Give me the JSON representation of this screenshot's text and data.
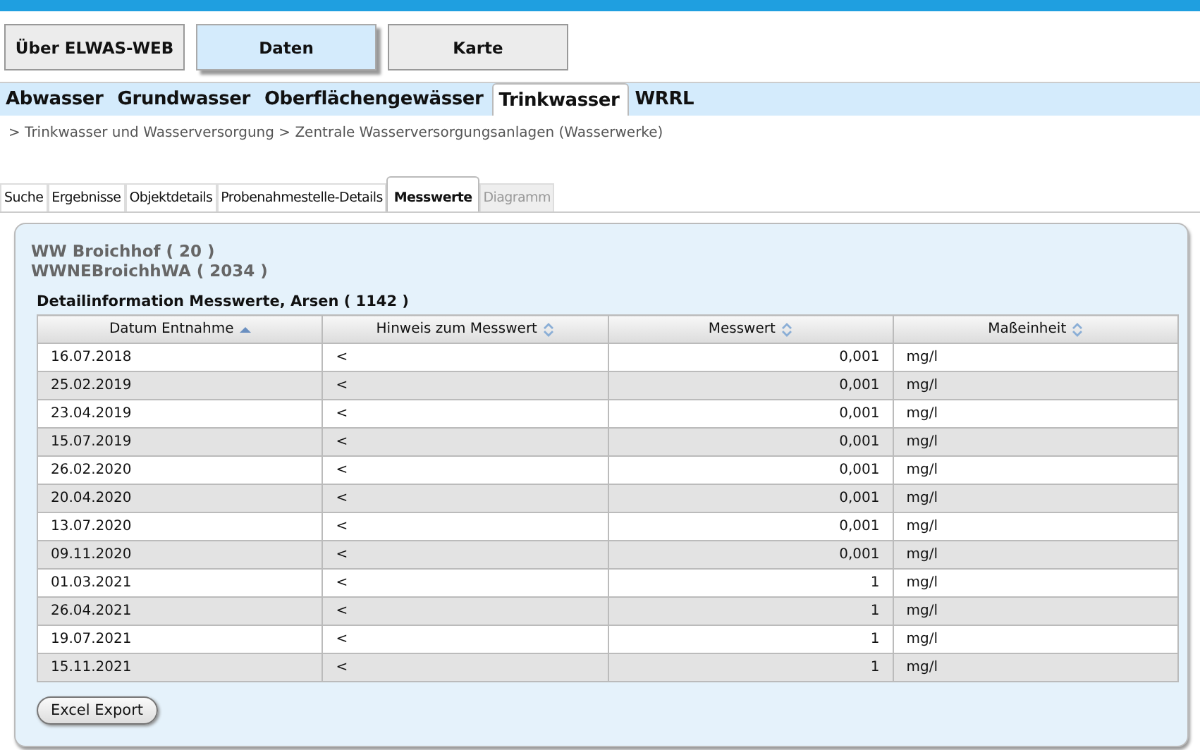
{
  "top_buttons": [
    {
      "label": "Über ELWAS-WEB",
      "selected": false
    },
    {
      "label": "Daten",
      "selected": true
    },
    {
      "label": "Karte",
      "selected": false
    }
  ],
  "nav_tabs": [
    {
      "label": "Abwasser",
      "selected": false
    },
    {
      "label": "Grundwasser",
      "selected": false
    },
    {
      "label": "Oberflächengewässer",
      "selected": false
    },
    {
      "label": "Trinkwasser",
      "selected": true
    },
    {
      "label": "WRRL",
      "selected": false
    }
  ],
  "breadcrumb": "> Trinkwasser und Wasserversorgung > Zentrale Wasserversorgungsanlagen (Wasserwerke)",
  "sub_tabs": [
    {
      "label": "Suche",
      "selected": false,
      "disabled": false
    },
    {
      "label": "Ergebnisse",
      "selected": false,
      "disabled": false
    },
    {
      "label": "Objektdetails",
      "selected": false,
      "disabled": false
    },
    {
      "label": "Probenahmestelle-Details",
      "selected": false,
      "disabled": false
    },
    {
      "label": "Messwerte",
      "selected": true,
      "disabled": false
    },
    {
      "label": "Diagramm",
      "selected": false,
      "disabled": true
    }
  ],
  "panel": {
    "heading_lines": [
      "WW Broichhof ( 20 )",
      "WWNEBroichhWA ( 2034 )"
    ],
    "table_title": "Detailinformation Messwerte, Arsen ( 1142 )",
    "columns": [
      {
        "label": "Datum Entnahme",
        "sorted": true,
        "numeric": false
      },
      {
        "label": "Hinweis zum Messwert",
        "sorted": false,
        "numeric": false
      },
      {
        "label": "Messwert",
        "sorted": false,
        "numeric": true
      },
      {
        "label": "Maßeinheit",
        "sorted": false,
        "numeric": false
      }
    ],
    "rows": [
      [
        "16.07.2018",
        "<",
        "0,001",
        "mg/l"
      ],
      [
        "25.02.2019",
        "<",
        "0,001",
        "mg/l"
      ],
      [
        "23.04.2019",
        "<",
        "0,001",
        "mg/l"
      ],
      [
        "15.07.2019",
        "<",
        "0,001",
        "mg/l"
      ],
      [
        "26.02.2020",
        "<",
        "0,001",
        "mg/l"
      ],
      [
        "20.04.2020",
        "<",
        "0,001",
        "mg/l"
      ],
      [
        "13.07.2020",
        "<",
        "0,001",
        "mg/l"
      ],
      [
        "09.11.2020",
        "<",
        "0,001",
        "mg/l"
      ],
      [
        "01.03.2021",
        "<",
        "1",
        "mg/l"
      ],
      [
        "26.04.2021",
        "<",
        "1",
        "mg/l"
      ],
      [
        "19.07.2021",
        "<",
        "1",
        "mg/l"
      ],
      [
        "15.11.2021",
        "<",
        "1",
        "mg/l"
      ]
    ],
    "export_button": "Excel Export"
  }
}
